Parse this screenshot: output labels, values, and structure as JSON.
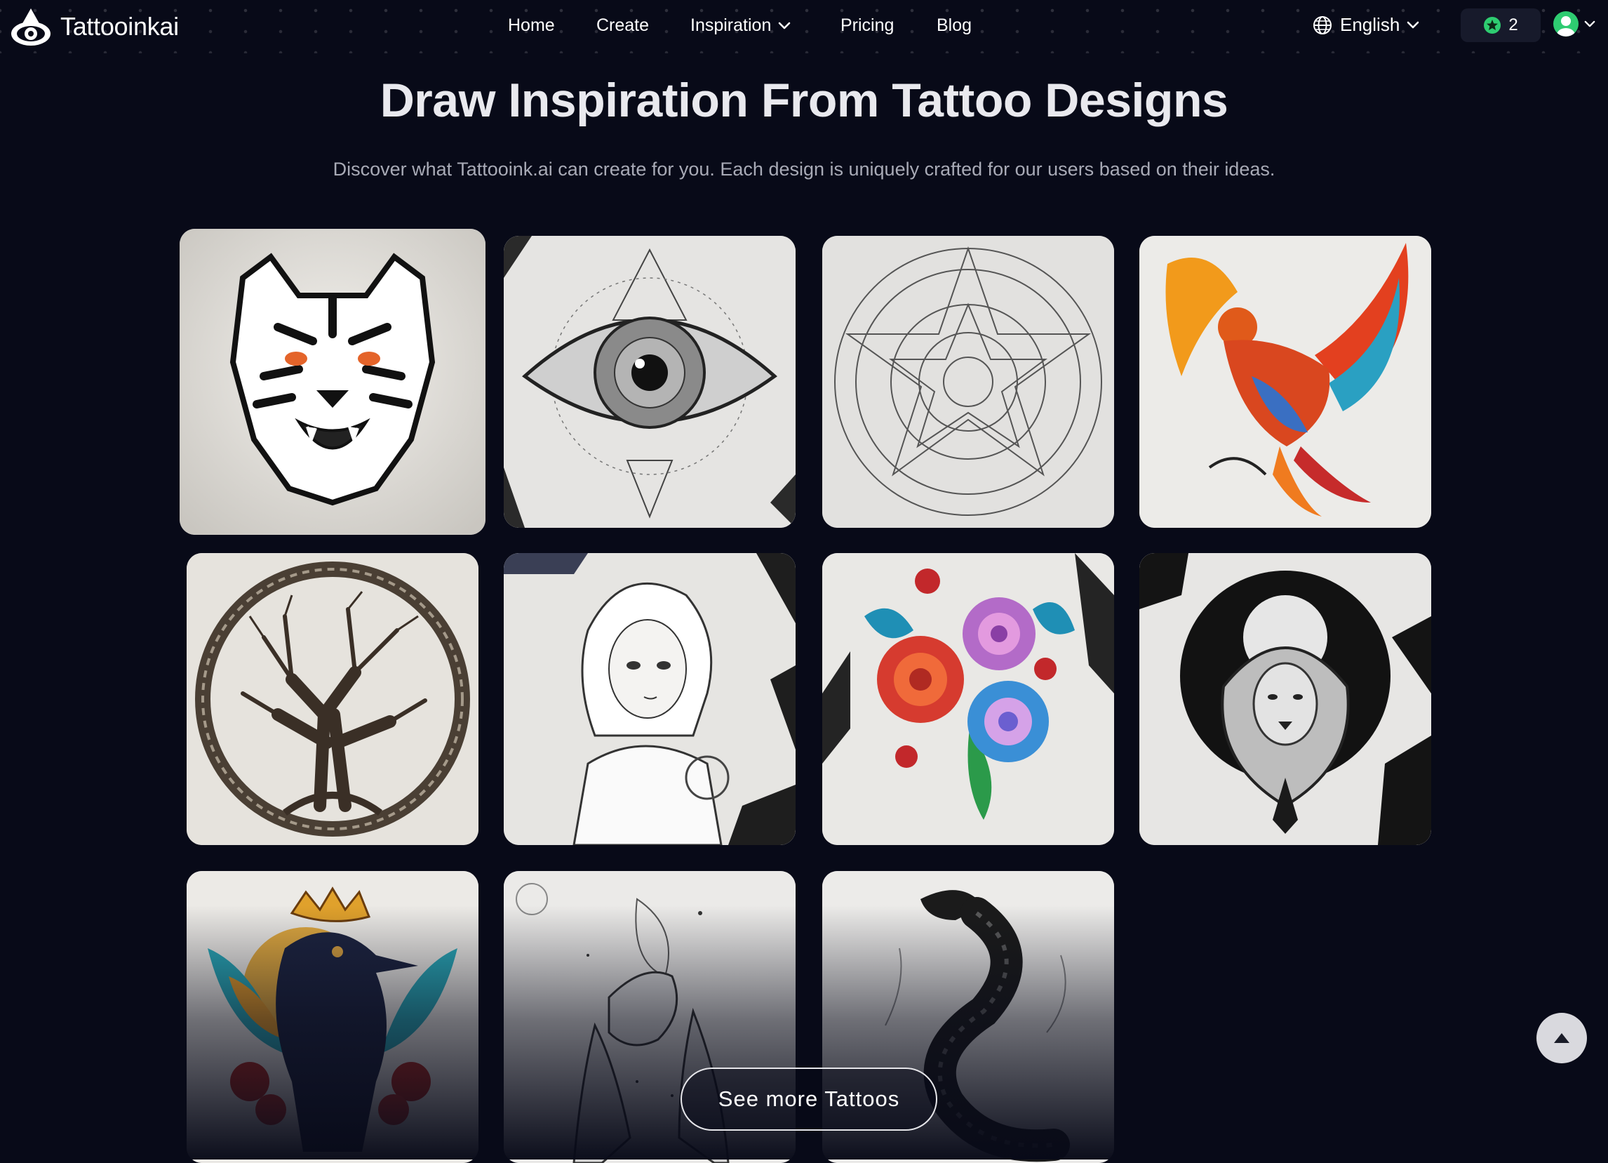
{
  "brand": {
    "name": "Tattooinkai"
  },
  "nav": {
    "items": [
      {
        "label": "Home"
      },
      {
        "label": "Create"
      },
      {
        "label": "Inspiration",
        "dropdown": true
      },
      {
        "label": "Pricing"
      },
      {
        "label": "Blog"
      }
    ],
    "language": "English",
    "credits": "2",
    "icons": [
      "eye-logo-icon",
      "globe-icon",
      "chevron-down-icon",
      "star-badge-icon",
      "user-avatar-icon"
    ]
  },
  "hero": {
    "title": "Draw Inspiration From Tattoo Designs",
    "subtitle": "Discover what Tattooink.ai can create for you. Each design is uniquely crafted for our users based on their ideas."
  },
  "gallery": {
    "items": [
      {
        "subject": "tiger"
      },
      {
        "subject": "eye"
      },
      {
        "subject": "mandala"
      },
      {
        "subject": "phoenix"
      },
      {
        "subject": "tree-of-life"
      },
      {
        "subject": "anime-girl"
      },
      {
        "subject": "roses"
      },
      {
        "subject": "lion-moon"
      },
      {
        "subject": "crowned-raven"
      },
      {
        "subject": "hands"
      },
      {
        "subject": "snake"
      }
    ]
  },
  "actions": {
    "see_more_label": "See more Tattoos",
    "scroll_top_icon": "arrow-up-icon"
  },
  "colors": {
    "background": "#080a18",
    "credit_badge": "#171a2b",
    "accent_green": "#2ecc71"
  }
}
